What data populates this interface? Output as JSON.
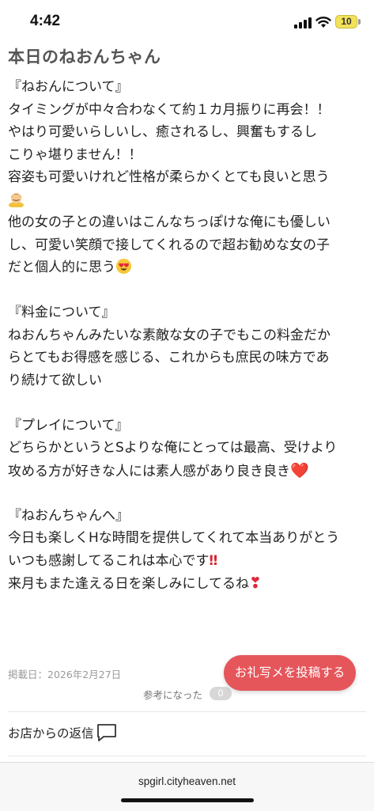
{
  "status": {
    "time": "4:42",
    "battery": "10"
  },
  "page_title": "本日のねおんちゃん",
  "review_lines": [
    "『ねおんについて』",
    "タイミングが中々合わなくて約１カ月振りに再会！！",
    "やはり可愛いらしいし、癒されるし、興奮もするし",
    "こりゃ堪りません！！",
    "容姿も可愛いけれど性格が柔らかくとても良いと思う",
    "",
    "他の女の子との違いはこんなちっぽけな俺にも優しい",
    "し、可愛い笑顔で接してくれるので超お勧めな女の子",
    "だと個人的に思う",
    "",
    "『料金について』",
    "ねおんちゃんみたいな素敵な女の子でもこの料金だか",
    "らとてもお得感を感じる、これからも庶民の味方であ",
    "り続けて欲しい",
    "",
    "『プレイについて』",
    "どちらかというとSよりな俺にとっては最高、受けより",
    "攻める方が好きな人には素人感があり良き良き",
    "",
    "『ねおんちゃんへ』",
    "今日も楽しくHな時間を提供してくれて本当ありがとう",
    "いつも感謝してるこれは本心です",
    "来月もまた逢える日を楽しみにしてるね"
  ],
  "emojis": {
    "bow": "person-bowing-icon",
    "heart_eyes": "heart-eyes-emoji-icon",
    "red_heart": "❤️",
    "double_exclamation": "‼",
    "heart_exclamation": "❣"
  },
  "posted_date": "掲載日：2026年2月27日",
  "helpful_label": "参考になった",
  "helpful_count": "0",
  "post_button_label": "お礼写メを投稿する",
  "reply_label": "お店からの返信",
  "url": "spgirl.cityheaven.net",
  "colors": {
    "accent": "#e5565b",
    "title": "#555555"
  }
}
